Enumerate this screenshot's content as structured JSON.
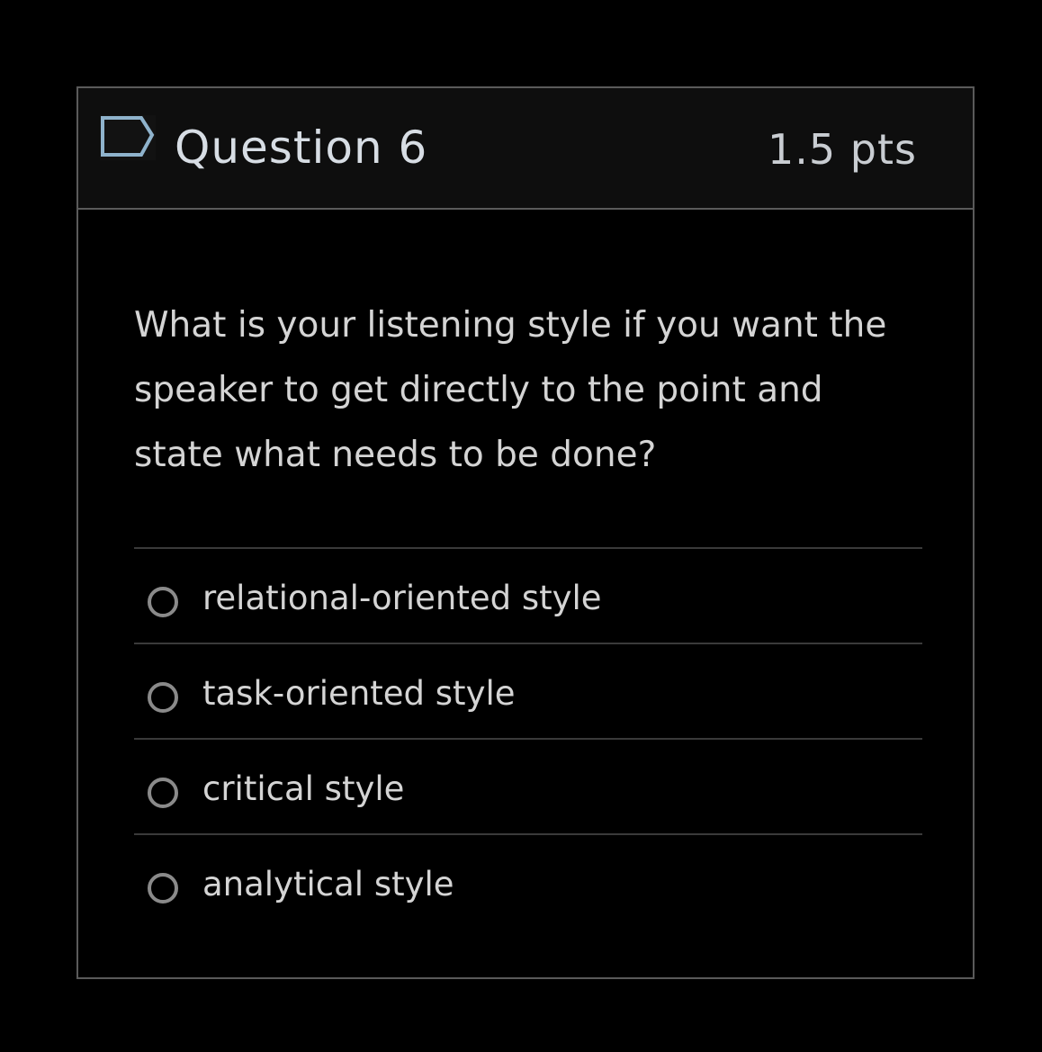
{
  "question": {
    "title": "Question 6",
    "points": "1.5 pts",
    "flag_icon": "flag-outline-icon",
    "text": "What is your listening style if you want the speaker to get directly to the point and state what needs to be done?"
  },
  "answers": [
    {
      "label": "relational-oriented style",
      "selected": false
    },
    {
      "label": "task-oriented style",
      "selected": false
    },
    {
      "label": "critical style",
      "selected": false
    },
    {
      "label": "analytical style",
      "selected": false
    }
  ],
  "colors": {
    "background": "#000000",
    "header_background": "#0e0e0e",
    "border": "#5a5a5a",
    "text": "#d4d4d4",
    "flag": "#8fb3cc"
  }
}
